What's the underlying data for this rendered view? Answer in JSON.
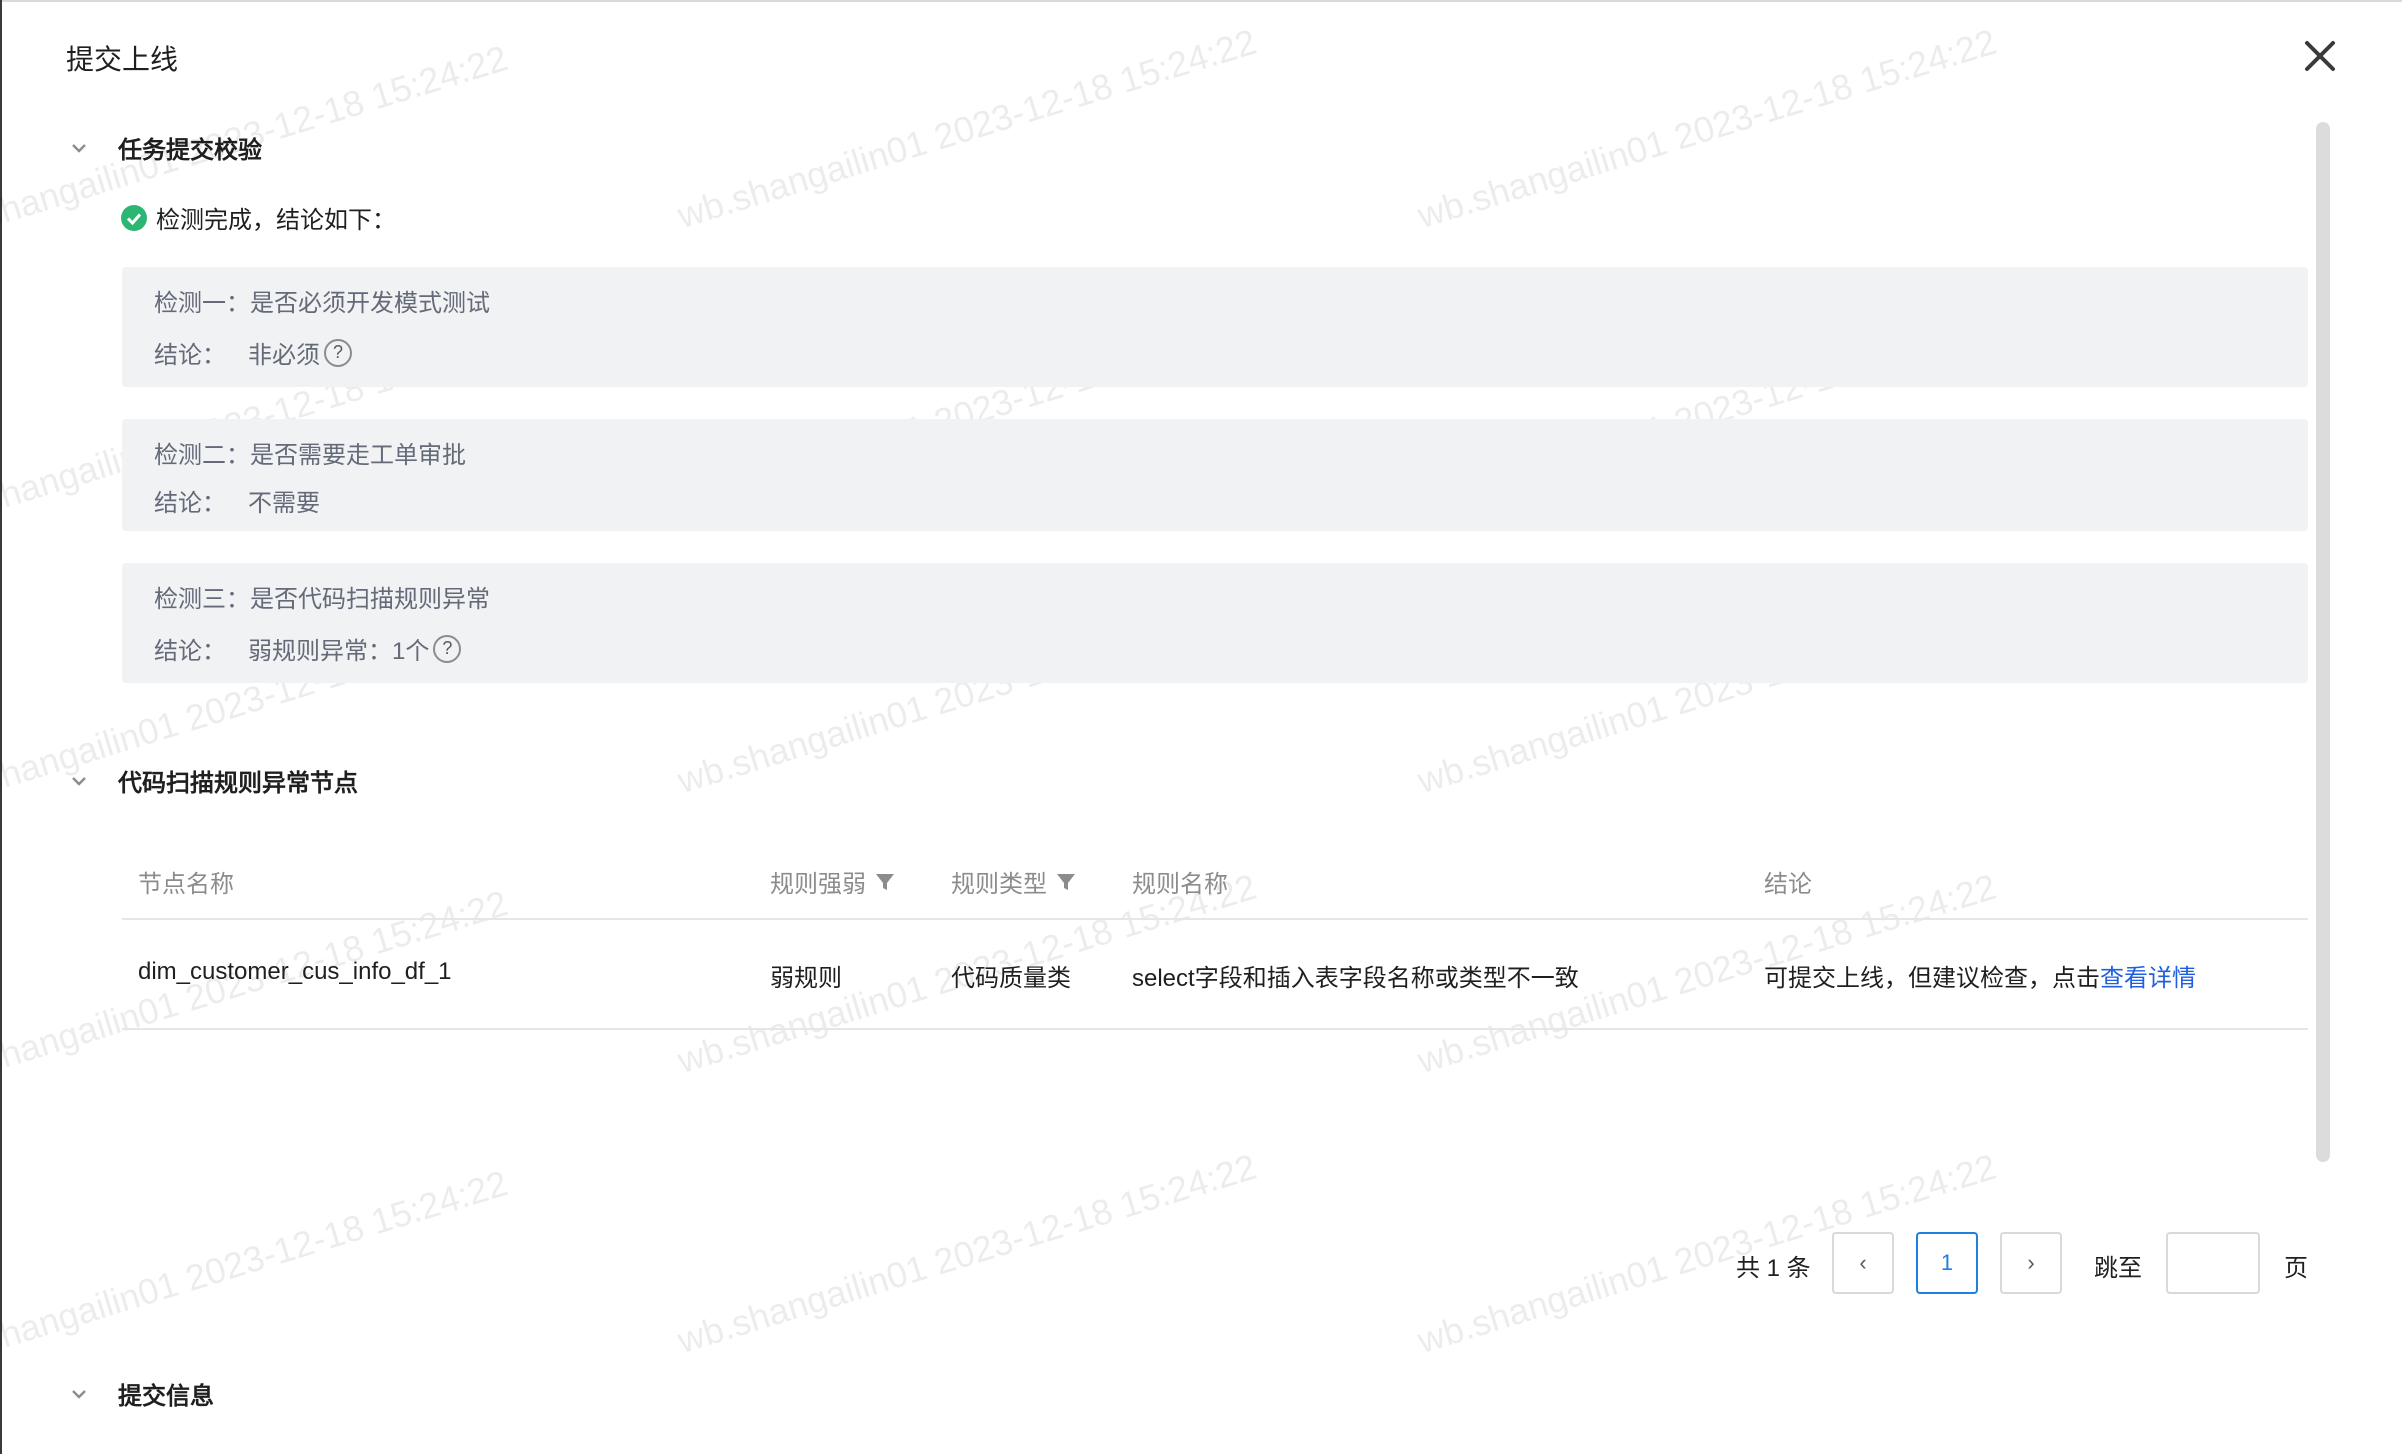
{
  "modal": {
    "title": "提交上线",
    "close_icon": "close-icon"
  },
  "watermark": {
    "texts": [
      "shangailin01 2023-12-18 15:24:22",
      "wb.shangailin01 2023-12-18 15:24:22",
      "wb.shangailin01 2023-12-18 15:24:22"
    ]
  },
  "section_validation": {
    "title": "任务提交校验",
    "status_text": "检测完成，结论如下：",
    "checks": [
      {
        "title": "检测一：是否必须开发模式测试",
        "conclusion_label": "结论：",
        "conclusion_value": "非必须",
        "has_help": true
      },
      {
        "title": "检测二：是否需要走工单审批",
        "conclusion_label": "结论：",
        "conclusion_value": "不需要",
        "has_help": false
      },
      {
        "title": "检测三：是否代码扫描规则异常",
        "conclusion_label": "结论：",
        "conclusion_value": "弱规则异常：1个",
        "has_help": true
      }
    ],
    "help_glyph": "?"
  },
  "section_anomaly": {
    "title": "代码扫描规则异常节点",
    "columns": [
      "节点名称",
      "规则强弱",
      "规则类型",
      "规则名称",
      "结论"
    ],
    "rows": [
      {
        "node_name": "dim_customer_cus_info_df_1",
        "strength": "弱规则",
        "type": "代码质量类",
        "rule_name": "select字段和插入表字段名称或类型不一致",
        "conclusion_text": "可提交上线，但建议检查，点击",
        "conclusion_link": "查看详情"
      }
    ]
  },
  "pagination": {
    "total": "共 1 条",
    "prev_glyph": "‹",
    "current_page": "1",
    "next_glyph": "›",
    "jump_label": "跳至",
    "jump_value": "",
    "page_suffix": "页"
  },
  "section_submit": {
    "title": "提交信息"
  },
  "colors": {
    "accent": "#1f7fe0",
    "link": "#1f5fe0",
    "success": "#2bb673",
    "panel_bg": "#f1f2f4"
  }
}
